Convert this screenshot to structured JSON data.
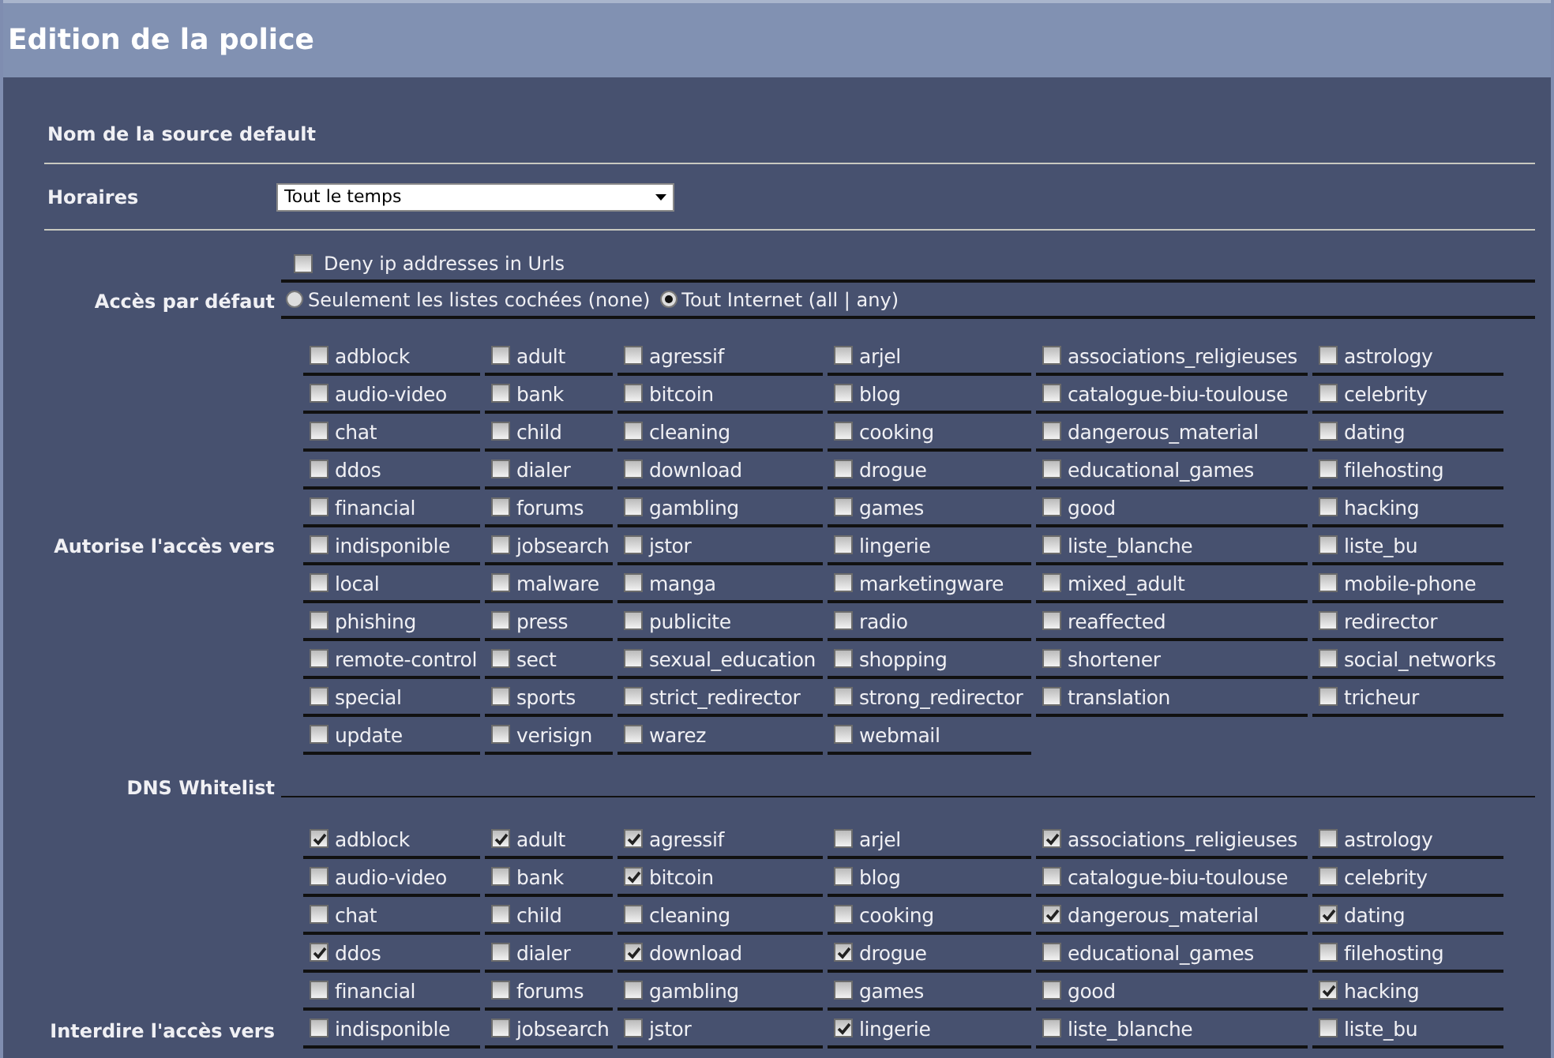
{
  "window": {
    "title": "Edition de la police"
  },
  "source_name": {
    "label": "Nom de la source default"
  },
  "schedule": {
    "label": "Horaires",
    "value": "Tout le temps"
  },
  "deny_ip": {
    "label": "Deny ip addresses in Urls",
    "checked": false
  },
  "default_access": {
    "label": "Accès par défaut",
    "options": [
      {
        "label": "Seulement les listes cochées (none)",
        "selected": false
      },
      {
        "label": "Tout Internet (all | any)",
        "selected": true
      }
    ]
  },
  "allow": {
    "label": "Autorise l'accès vers",
    "items": [
      {
        "label": "adblock",
        "checked": false
      },
      {
        "label": "adult",
        "checked": false
      },
      {
        "label": "agressif",
        "checked": false
      },
      {
        "label": "arjel",
        "checked": false
      },
      {
        "label": "associations_religieuses",
        "checked": false
      },
      {
        "label": "astrology",
        "checked": false
      },
      {
        "label": "audio-video",
        "checked": false
      },
      {
        "label": "bank",
        "checked": false
      },
      {
        "label": "bitcoin",
        "checked": false
      },
      {
        "label": "blog",
        "checked": false
      },
      {
        "label": "catalogue-biu-toulouse",
        "checked": false
      },
      {
        "label": "celebrity",
        "checked": false
      },
      {
        "label": "chat",
        "checked": false
      },
      {
        "label": "child",
        "checked": false
      },
      {
        "label": "cleaning",
        "checked": false
      },
      {
        "label": "cooking",
        "checked": false
      },
      {
        "label": "dangerous_material",
        "checked": false
      },
      {
        "label": "dating",
        "checked": false
      },
      {
        "label": "ddos",
        "checked": false
      },
      {
        "label": "dialer",
        "checked": false
      },
      {
        "label": "download",
        "checked": false
      },
      {
        "label": "drogue",
        "checked": false
      },
      {
        "label": "educational_games",
        "checked": false
      },
      {
        "label": "filehosting",
        "checked": false
      },
      {
        "label": "financial",
        "checked": false
      },
      {
        "label": "forums",
        "checked": false
      },
      {
        "label": "gambling",
        "checked": false
      },
      {
        "label": "games",
        "checked": false
      },
      {
        "label": "good",
        "checked": false
      },
      {
        "label": "hacking",
        "checked": false
      },
      {
        "label": "indisponible",
        "checked": false
      },
      {
        "label": "jobsearch",
        "checked": false
      },
      {
        "label": "jstor",
        "checked": false
      },
      {
        "label": "lingerie",
        "checked": false
      },
      {
        "label": "liste_blanche",
        "checked": false
      },
      {
        "label": "liste_bu",
        "checked": false
      },
      {
        "label": "local",
        "checked": false
      },
      {
        "label": "malware",
        "checked": false
      },
      {
        "label": "manga",
        "checked": false
      },
      {
        "label": "marketingware",
        "checked": false
      },
      {
        "label": "mixed_adult",
        "checked": false
      },
      {
        "label": "mobile-phone",
        "checked": false
      },
      {
        "label": "phishing",
        "checked": false
      },
      {
        "label": "press",
        "checked": false
      },
      {
        "label": "publicite",
        "checked": false
      },
      {
        "label": "radio",
        "checked": false
      },
      {
        "label": "reaffected",
        "checked": false
      },
      {
        "label": "redirector",
        "checked": false
      },
      {
        "label": "remote-control",
        "checked": false
      },
      {
        "label": "sect",
        "checked": false
      },
      {
        "label": "sexual_education",
        "checked": false
      },
      {
        "label": "shopping",
        "checked": false
      },
      {
        "label": "shortener",
        "checked": false
      },
      {
        "label": "social_networks",
        "checked": false
      },
      {
        "label": "special",
        "checked": false
      },
      {
        "label": "sports",
        "checked": false
      },
      {
        "label": "strict_redirector",
        "checked": false
      },
      {
        "label": "strong_redirector",
        "checked": false
      },
      {
        "label": "translation",
        "checked": false
      },
      {
        "label": "tricheur",
        "checked": false
      },
      {
        "label": "update",
        "checked": false
      },
      {
        "label": "verisign",
        "checked": false
      },
      {
        "label": "warez",
        "checked": false
      },
      {
        "label": "webmail",
        "checked": false
      }
    ]
  },
  "dns_whitelist": {
    "label": "DNS Whitelist"
  },
  "deny": {
    "label": "Interdire l'accès vers",
    "items": [
      {
        "label": "adblock",
        "checked": true
      },
      {
        "label": "adult",
        "checked": true
      },
      {
        "label": "agressif",
        "checked": true
      },
      {
        "label": "arjel",
        "checked": false
      },
      {
        "label": "associations_religieuses",
        "checked": true
      },
      {
        "label": "astrology",
        "checked": false
      },
      {
        "label": "audio-video",
        "checked": false
      },
      {
        "label": "bank",
        "checked": false
      },
      {
        "label": "bitcoin",
        "checked": true
      },
      {
        "label": "blog",
        "checked": false
      },
      {
        "label": "catalogue-biu-toulouse",
        "checked": false
      },
      {
        "label": "celebrity",
        "checked": false
      },
      {
        "label": "chat",
        "checked": false
      },
      {
        "label": "child",
        "checked": false
      },
      {
        "label": "cleaning",
        "checked": false
      },
      {
        "label": "cooking",
        "checked": false
      },
      {
        "label": "dangerous_material",
        "checked": true
      },
      {
        "label": "dating",
        "checked": true
      },
      {
        "label": "ddos",
        "checked": true
      },
      {
        "label": "dialer",
        "checked": false
      },
      {
        "label": "download",
        "checked": true
      },
      {
        "label": "drogue",
        "checked": true
      },
      {
        "label": "educational_games",
        "checked": false
      },
      {
        "label": "filehosting",
        "checked": false
      },
      {
        "label": "financial",
        "checked": false
      },
      {
        "label": "forums",
        "checked": false
      },
      {
        "label": "gambling",
        "checked": false
      },
      {
        "label": "games",
        "checked": false
      },
      {
        "label": "good",
        "checked": false
      },
      {
        "label": "hacking",
        "checked": true
      },
      {
        "label": "indisponible",
        "checked": false
      },
      {
        "label": "jobsearch",
        "checked": false
      },
      {
        "label": "jstor",
        "checked": false
      },
      {
        "label": "lingerie",
        "checked": true
      },
      {
        "label": "liste_blanche",
        "checked": false
      },
      {
        "label": "liste_bu",
        "checked": false
      }
    ]
  }
}
